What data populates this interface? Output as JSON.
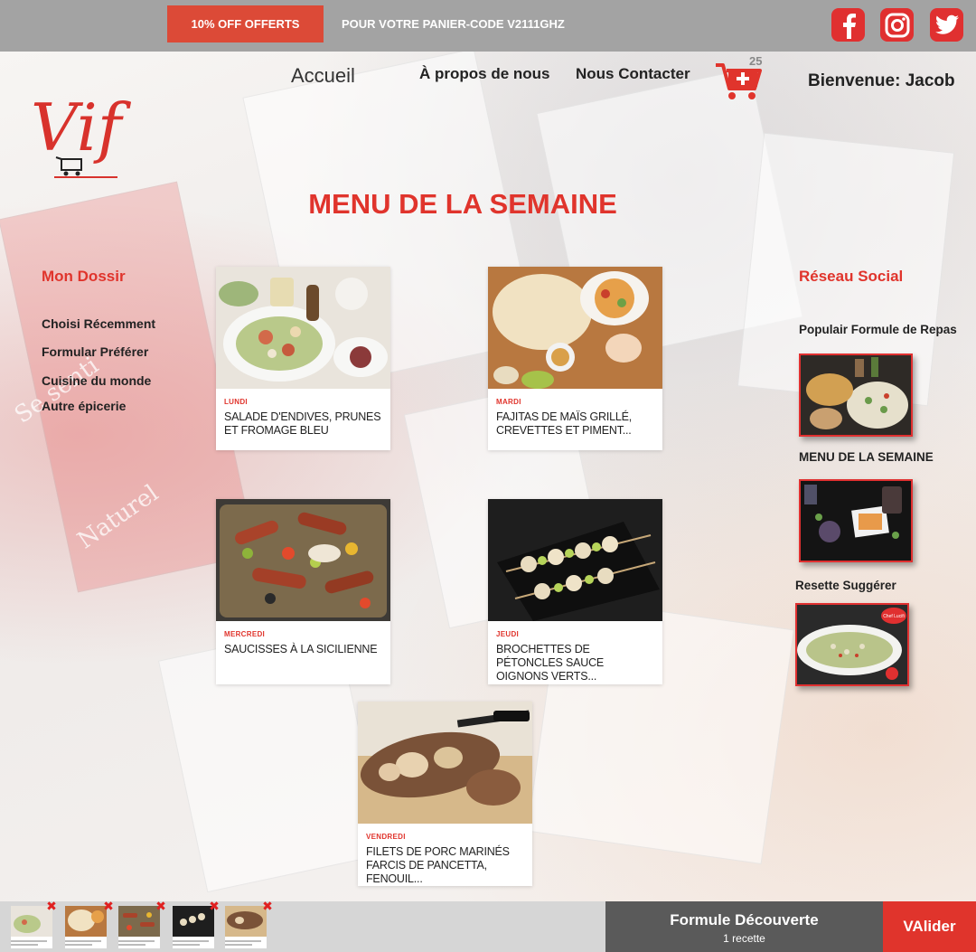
{
  "promo": {
    "badge": "10% OFF OFFERTS",
    "text": "POUR VOTRE PANIER-CODE V2111GHZ"
  },
  "social_icons": [
    "facebook-icon",
    "instagram-icon",
    "twitter-icon"
  ],
  "header": {
    "logo_text": "Vif",
    "nav": {
      "home": "Accueil",
      "about": "À propos de nous",
      "contact": "Nous Contacter"
    },
    "cart_count": "25",
    "welcome": "Bienvenue: Jacob"
  },
  "page_title": "MENU DE LA SEMAINE",
  "left_sidebar": {
    "title": "Mon Dossir",
    "items": [
      "Choisi Récemment",
      "Formular Préférer",
      "Cuisine du monde",
      "Autre épicerie"
    ]
  },
  "menu": [
    {
      "day": "LUNDI",
      "title": "SALADE D'ENDIVES, PRUNES ET FROMAGE BLEU"
    },
    {
      "day": "MARDI",
      "title": "FAJITAS DE MAÏS GRILLÉ, CREVETTES ET PIMENT..."
    },
    {
      "day": "MERCREDI",
      "title": "SAUCISSES À LA SICILIENNE"
    },
    {
      "day": "JEUDI",
      "title": "BROCHETTES DE PÉTONCLES SAUCE OIGNONS VERTS..."
    },
    {
      "day": "VENDREDI",
      "title": "FILETS DE PORC MARINÉS FARCIS DE PANCETTA, FENOUIL..."
    }
  ],
  "right_sidebar": {
    "title": "Réseau Social",
    "sections": [
      "Populair Formule de Repas",
      "MENU DE LA SEMAINE",
      "Resette Suggérer"
    ],
    "badge_text": "Chef Lucifi"
  },
  "bottom": {
    "formule_title": "Formule Découverte",
    "formule_sub": "1 recette",
    "validate": "VAlider"
  },
  "colors": {
    "accent": "#e0342c",
    "topbar": "#a3a3a3",
    "bottombar": "#d6d6d6",
    "formule": "#5a5a5a"
  }
}
